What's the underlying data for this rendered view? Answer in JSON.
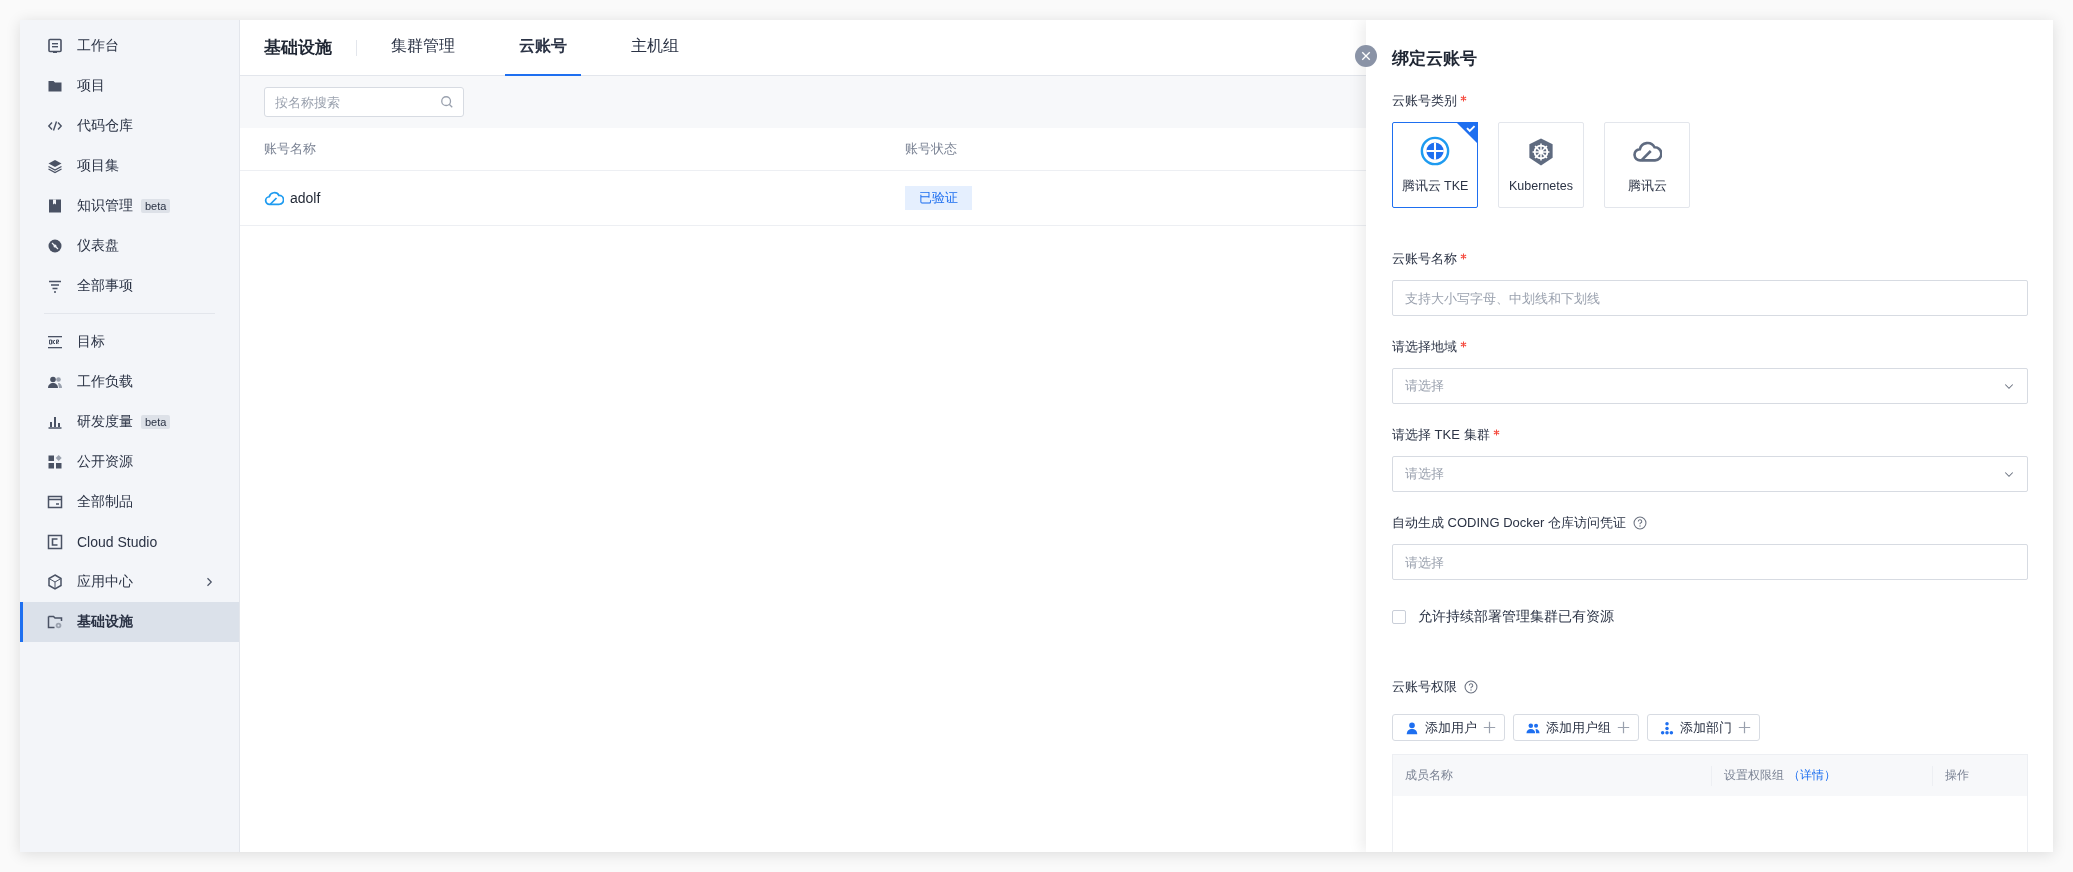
{
  "sidebar": {
    "sections": [
      {
        "items": [
          {
            "label": "工作台",
            "selected": false
          },
          {
            "label": "项目",
            "selected": false
          },
          {
            "label": "代码仓库",
            "selected": false
          },
          {
            "label": "项目集",
            "selected": false
          },
          {
            "label": "知识管理",
            "badge": "beta",
            "selected": false
          },
          {
            "label": "仪表盘",
            "selected": false
          },
          {
            "label": "全部事项",
            "selected": false
          }
        ]
      },
      {
        "items": [
          {
            "label": "目标",
            "selected": false
          },
          {
            "label": "工作负载",
            "selected": false
          },
          {
            "label": "研发度量",
            "badge": "beta",
            "selected": false
          },
          {
            "label": "公开资源",
            "selected": false
          },
          {
            "label": "全部制品",
            "selected": false
          },
          {
            "label": "Cloud Studio",
            "selected": false
          },
          {
            "label": "应用中心",
            "submenu": true,
            "selected": false
          },
          {
            "label": "基础设施",
            "selected": true
          }
        ]
      }
    ]
  },
  "header": {
    "title": "基础设施",
    "tabs": [
      {
        "label": "集群管理",
        "selected": false
      },
      {
        "label": "云账号",
        "selected": true
      },
      {
        "label": "主机组",
        "selected": false
      }
    ]
  },
  "search": {
    "placeholder": "按名称搜索"
  },
  "table": {
    "columns": [
      "账号名称",
      "账号状态"
    ],
    "rows": [
      {
        "name": "adolf",
        "status": "已验证"
      }
    ]
  },
  "drawer": {
    "title": "绑定云账号",
    "fields": [
      {
        "kind": "cards",
        "label": "云账号类别",
        "required": true,
        "options": [
          {
            "label": "腾讯云 TKE",
            "selected": true
          },
          {
            "label": "Kubernetes",
            "selected": false
          },
          {
            "label": "腾讯云",
            "selected": false
          }
        ]
      },
      {
        "kind": "text",
        "label": "云账号名称",
        "required": true,
        "placeholder": "支持大小写字母、中划线和下划线"
      },
      {
        "kind": "select",
        "label": "请选择地域",
        "required": true,
        "placeholder": "请选择"
      },
      {
        "kind": "select",
        "label": "请选择 TKE 集群",
        "required": true,
        "placeholder": "请选择"
      },
      {
        "kind": "text",
        "label": "自动生成 CODING Docker 仓库访问凭证",
        "help": true,
        "placeholder": "请选择"
      },
      {
        "kind": "checkbox",
        "label": "允许持续部署管理集群已有资源",
        "checked": false
      },
      {
        "kind": "permissions",
        "label": "云账号权限",
        "help": true,
        "buttons": [
          "添加用户",
          "添加用户组",
          "添加部门"
        ],
        "columns": [
          {
            "label": "成员名称"
          },
          {
            "label": "设置权限组",
            "link": "（详情）"
          },
          {
            "label": "操作"
          }
        ]
      }
    ]
  }
}
